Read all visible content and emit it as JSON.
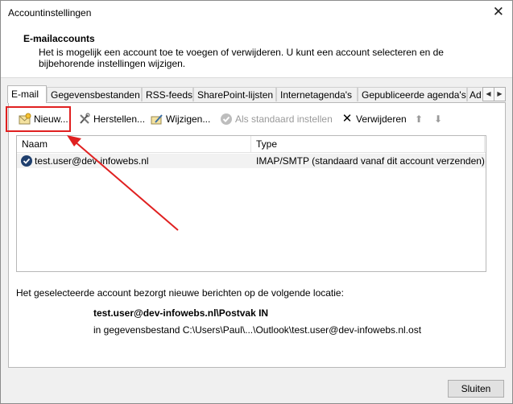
{
  "window": {
    "title": "Accountinstellingen",
    "close_glyph": "✕"
  },
  "header": {
    "title": "E-mailaccounts",
    "description": "Het is mogelijk een account toe te voegen of verwijderen. U kunt een account selecteren en de bijbehorende instellingen wijzigen."
  },
  "tabs": [
    {
      "label": "E-mail",
      "active": true
    },
    {
      "label": "Gegevensbestanden"
    },
    {
      "label": "RSS-feeds"
    },
    {
      "label": "SharePoint-lijsten"
    },
    {
      "label": "Internetagenda's"
    },
    {
      "label": "Gepubliceerde agenda's"
    },
    {
      "label": "Ad"
    }
  ],
  "tab_scroll": {
    "left": "◀",
    "right": "▶"
  },
  "toolbar": {
    "new_label": "Nieuw...",
    "repair_label": "Herstellen...",
    "change_label": "Wijzigen...",
    "default_label": "Als standaard instellen",
    "remove_label": "Verwijderen",
    "up_glyph": "⬆",
    "down_glyph": "⬇",
    "remove_glyph": "✕"
  },
  "list": {
    "columns": [
      "Naam",
      "Type"
    ],
    "rows": [
      {
        "name": "test.user@dev-infowebs.nl",
        "type": "IMAP/SMTP (standaard vanaf dit account verzenden)"
      }
    ]
  },
  "location": {
    "intro": "Het geselecteerde account bezorgt nieuwe berichten op de volgende locatie:",
    "folder": "test.user@dev-infowebs.nl\\Postvak IN",
    "path": "in gegevensbestand C:\\Users\\Paul\\...\\Outlook\\test.user@dev-infowebs.nl.ost"
  },
  "footer": {
    "close_label": "Sluiten"
  },
  "colors": {
    "highlight": "#e02020",
    "arrow": "#e02020",
    "selected_row": "#f2f2f2"
  }
}
